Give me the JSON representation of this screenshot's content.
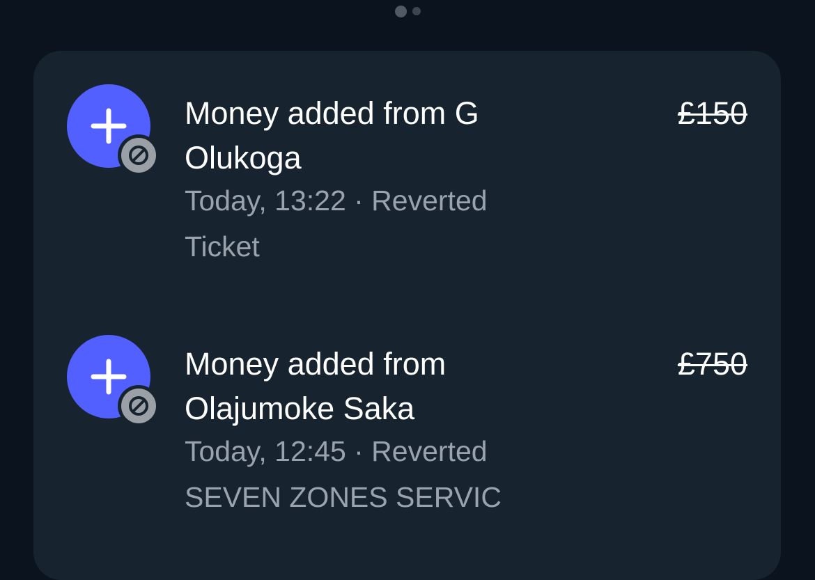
{
  "pager": {
    "pages": 2,
    "active_index": 0
  },
  "colors": {
    "background": "#0a131e",
    "card": "#17242f",
    "avatar_accent": "#5260ff",
    "badge_grey": "#9aa0a6",
    "primary_text": "#ffffff",
    "secondary_text": "#9aa3ad"
  },
  "transactions": [
    {
      "title": "Money added from G Olukoga",
      "meta": "Today, 13:22 · Reverted",
      "reference": "Ticket",
      "amount": "£150",
      "icon": "plus-icon",
      "status_icon": "reverted-icon"
    },
    {
      "title": "Money added from Olajumoke Saka",
      "meta": "Today, 12:45 · Reverted",
      "reference": "SEVEN ZONES SERVIC",
      "amount": "£750",
      "icon": "plus-icon",
      "status_icon": "reverted-icon"
    }
  ]
}
